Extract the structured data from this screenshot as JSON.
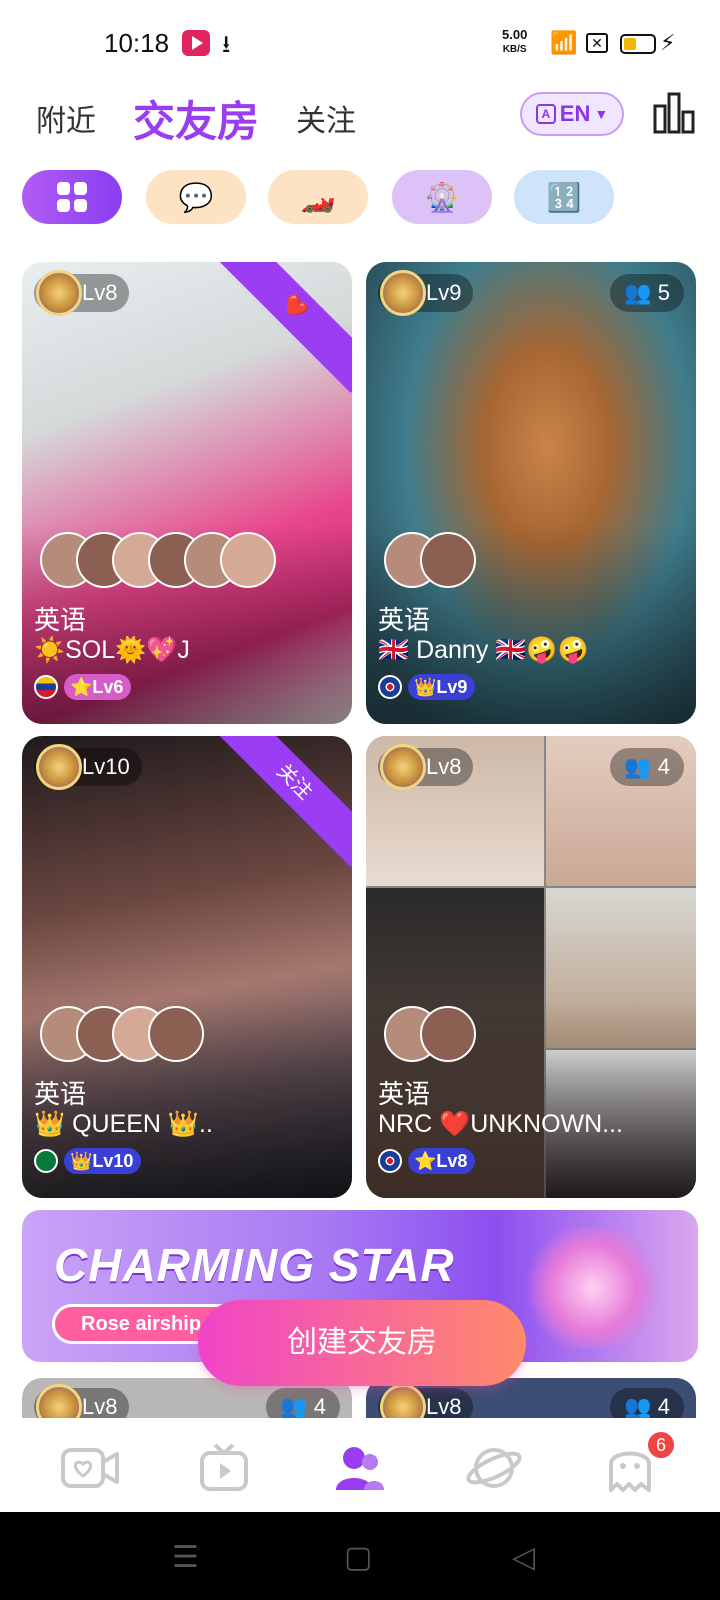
{
  "status_bar": {
    "time": "10:18",
    "speed_value": "5.00",
    "speed_unit": "KB/S"
  },
  "header": {
    "tabs": [
      {
        "label": "附近"
      },
      {
        "label": "交友房",
        "active": true
      },
      {
        "label": "关注"
      }
    ],
    "language_button": "EN"
  },
  "chips": [
    {
      "icon": "grid-icon",
      "active": true
    },
    {
      "icon": "chat-bubbles-icon"
    },
    {
      "icon": "racing-car-icon"
    },
    {
      "icon": "spin-wheel-icon"
    },
    {
      "icon": "number-puzzle-icon"
    }
  ],
  "rooms": [
    {
      "level": "Lv8",
      "ribbon": "heart",
      "language": "英语",
      "name": "☀️SOL🌞💖J",
      "host_level": "⭐Lv6",
      "flag": "VE"
    },
    {
      "level": "Lv9",
      "count": "5",
      "language": "英语",
      "name": "🇬🇧 Danny 🇬🇧🤪🤪",
      "host_level": "👑Lv9",
      "flag": "GB"
    },
    {
      "level": "Lv10",
      "ribbon": "关注",
      "language": "英语",
      "name": "👑 QUEEN 👑..",
      "host_level": "👑Lv10",
      "flag": "SA"
    },
    {
      "level": "Lv8",
      "count": "4",
      "language": "英语",
      "name": "NRC ❤️UNKNOWN...",
      "host_level": "⭐Lv8",
      "flag": "GB"
    }
  ],
  "banner": {
    "title": "CHARMING STAR",
    "subtitle": "Rose airship"
  },
  "create_button": "创建交友房",
  "partial_rooms": [
    {
      "level": "Lv8",
      "count": "4"
    },
    {
      "level": "Lv8",
      "count": "4"
    }
  ],
  "bottom_nav": {
    "items": [
      {
        "icon": "video-heart-icon"
      },
      {
        "icon": "tv-play-icon"
      },
      {
        "icon": "friends-room-icon",
        "active": true
      },
      {
        "icon": "planet-icon"
      },
      {
        "icon": "ghost-message-icon",
        "badge": "6"
      }
    ]
  },
  "colors": {
    "accent": "#9a3cf0",
    "create_start": "#f044c8",
    "create_end": "#ff8b6a",
    "badge": "#f04444"
  }
}
